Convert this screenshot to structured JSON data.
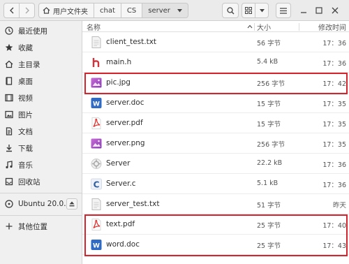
{
  "header": {
    "breadcrumbs": [
      "用户文件夹",
      "chat",
      "CS",
      "server"
    ]
  },
  "sidebar": {
    "items": [
      {
        "label": "最近使用",
        "icon": "clock-icon"
      },
      {
        "label": "收藏",
        "icon": "star-icon"
      },
      {
        "label": "主目录",
        "icon": "home-icon"
      },
      {
        "label": "桌面",
        "icon": "desktop-icon"
      },
      {
        "label": "视频",
        "icon": "video-icon"
      },
      {
        "label": "图片",
        "icon": "picture-icon"
      },
      {
        "label": "文档",
        "icon": "document-icon"
      },
      {
        "label": "下载",
        "icon": "download-icon"
      },
      {
        "label": "音乐",
        "icon": "music-icon"
      },
      {
        "label": "回收站",
        "icon": "trash-icon"
      }
    ],
    "device": {
      "label": "Ubuntu 20.0…",
      "icon": "disc-icon"
    },
    "other": {
      "label": "其他位置",
      "icon": "plus-icon"
    }
  },
  "columns": {
    "name": "名称",
    "size": "大小",
    "modified": "修改时间"
  },
  "files": [
    {
      "name": "client_test.txt",
      "size": "56 字节",
      "modified": "17：36",
      "type": "text"
    },
    {
      "name": "main.h",
      "size": "5.4 kB",
      "modified": "17：36",
      "type": "header"
    },
    {
      "name": "pic.jpg",
      "size": "256 字节",
      "modified": "17：42",
      "type": "image"
    },
    {
      "name": "server.doc",
      "size": "15 字节",
      "modified": "17：35",
      "type": "doc"
    },
    {
      "name": "server.pdf",
      "size": "15 字节",
      "modified": "17：35",
      "type": "pdf"
    },
    {
      "name": "server.png",
      "size": "256 字节",
      "modified": "17：35",
      "type": "image"
    },
    {
      "name": "Server",
      "size": "22.2 kB",
      "modified": "17：36",
      "type": "exec"
    },
    {
      "name": "Server.c",
      "size": "5.1 kB",
      "modified": "17：36",
      "type": "c"
    },
    {
      "name": "server_test.txt",
      "size": "51 字节",
      "modified": "昨天",
      "type": "text"
    },
    {
      "name": "text.pdf",
      "size": "25 字节",
      "modified": "17：40",
      "type": "pdf"
    },
    {
      "name": "word.doc",
      "size": "25 字节",
      "modified": "17：43",
      "type": "doc"
    }
  ],
  "colors": {
    "highlight": "#d4252f",
    "pdf": "#e0312f",
    "doc": "#2f6bc4",
    "image": "#a44fc7"
  }
}
